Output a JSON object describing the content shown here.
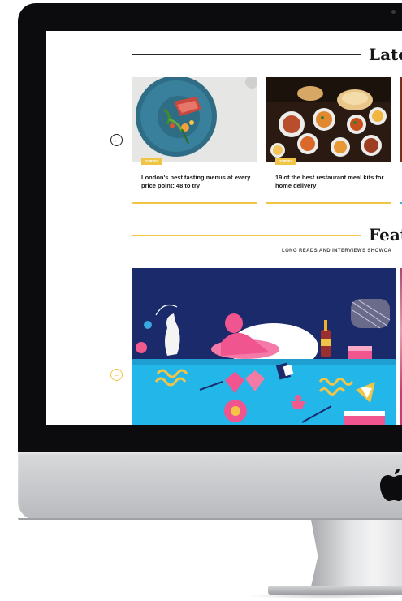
{
  "sections": {
    "latest": {
      "title": "Late"
    },
    "featured": {
      "title": "Featu",
      "subtitle": "LONG READS AND INTERVIEWS SHOWCA"
    }
  },
  "navigation": {
    "prev_arrow_glyph": "←",
    "featured_prev_arrow_glyph": "←"
  },
  "articles": [
    {
      "tag": "GUIDES",
      "title": "London's best tasting menus at every price point: 48 to try"
    },
    {
      "tag": "GUIDES",
      "title": "19 of the best restaurant meal kits for home delivery"
    }
  ],
  "colors": {
    "accent_gold": "#f0c545",
    "feature_navy": "#1b2a6b",
    "feature_cyan": "#22b7e8",
    "feature_pink": "#f0558f"
  },
  "icons": {
    "apple_logo": "apple-logo-icon",
    "arrow_left": "arrow-left-icon"
  }
}
